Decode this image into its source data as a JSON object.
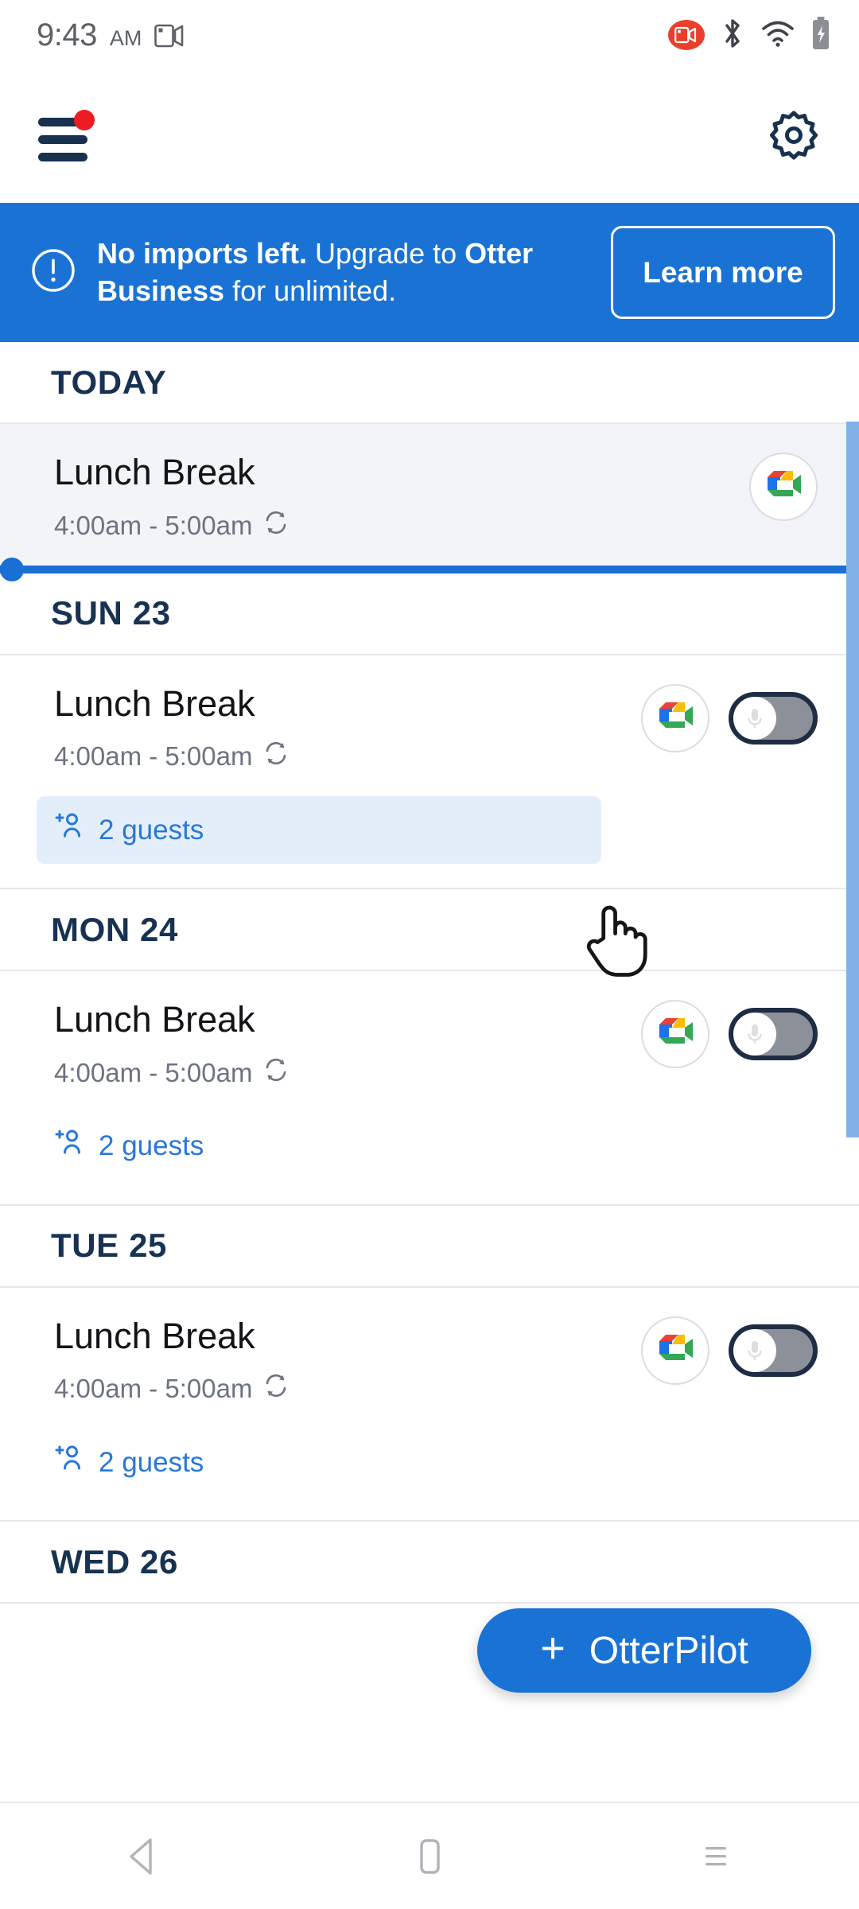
{
  "status_bar": {
    "time": "9:43",
    "ampm": "AM",
    "icons": [
      "screen-record-icon",
      "recording-badge-icon",
      "bluetooth-icon",
      "wifi-icon",
      "battery-charging-icon"
    ]
  },
  "top_bar": {
    "menu_icon": "hamburger-menu-icon",
    "menu_has_notification": true,
    "settings_icon": "gear-icon"
  },
  "banner": {
    "icon": "alert-circle-icon",
    "text_bold_1": "No imports left.",
    "text_normal_1": " Upgrade to ",
    "text_bold_2": "Otter",
    "text_normal_2": " ",
    "text_bold_3": "Business",
    "text_normal_3": " for unlimited.",
    "button_label": "Learn more",
    "background_color": "#1a73d4"
  },
  "list": {
    "sections": [
      {
        "day_label": "TODAY",
        "event": {
          "title": "Lunch Break",
          "time": "4:00am - 5:00am",
          "recurring_icon": "recurring-refresh-icon",
          "meet_icon": "google-meet-icon",
          "has_toggle": false,
          "guests": null,
          "highlighted": false,
          "is_current": true
        }
      },
      {
        "day_label": "SUN 23",
        "event": {
          "title": "Lunch Break",
          "time": "4:00am - 5:00am",
          "recurring_icon": "recurring-refresh-icon",
          "meet_icon": "google-meet-icon",
          "has_toggle": true,
          "toggle_state": "off",
          "toggle_icon": "microphone-icon",
          "guests": "2 guests",
          "guests_icon": "add-person-icon",
          "highlighted": true,
          "is_current": false
        }
      },
      {
        "day_label": "MON 24",
        "event": {
          "title": "Lunch Break",
          "time": "4:00am - 5:00am",
          "recurring_icon": "recurring-refresh-icon",
          "meet_icon": "google-meet-icon",
          "has_toggle": true,
          "toggle_state": "off",
          "toggle_icon": "microphone-icon",
          "guests": "2 guests",
          "guests_icon": "add-person-icon",
          "highlighted": false,
          "is_current": false
        }
      },
      {
        "day_label": "TUE 25",
        "event": {
          "title": "Lunch Break",
          "time": "4:00am - 5:00am",
          "recurring_icon": "recurring-refresh-icon",
          "meet_icon": "google-meet-icon",
          "has_toggle": true,
          "toggle_state": "off",
          "toggle_icon": "microphone-icon",
          "guests": "2 guests",
          "guests_icon": "add-person-icon",
          "highlighted": false,
          "is_current": false
        }
      },
      {
        "day_label": "WED 26",
        "event": null
      }
    ]
  },
  "fab": {
    "plus": "+",
    "label": "OtterPilot",
    "color": "#1a73d4"
  },
  "nav_bar": {
    "back_icon": "back-triangle-icon",
    "home_icon": "home-square-icon",
    "recents_icon": "recents-lines-icon"
  },
  "colors": {
    "accent_blue": "#1a73d4",
    "dark_navy": "#173253",
    "highlight_blue": "#e4eefb",
    "card_gray": "#f2f4f7",
    "notification_red": "#ec1c24"
  }
}
